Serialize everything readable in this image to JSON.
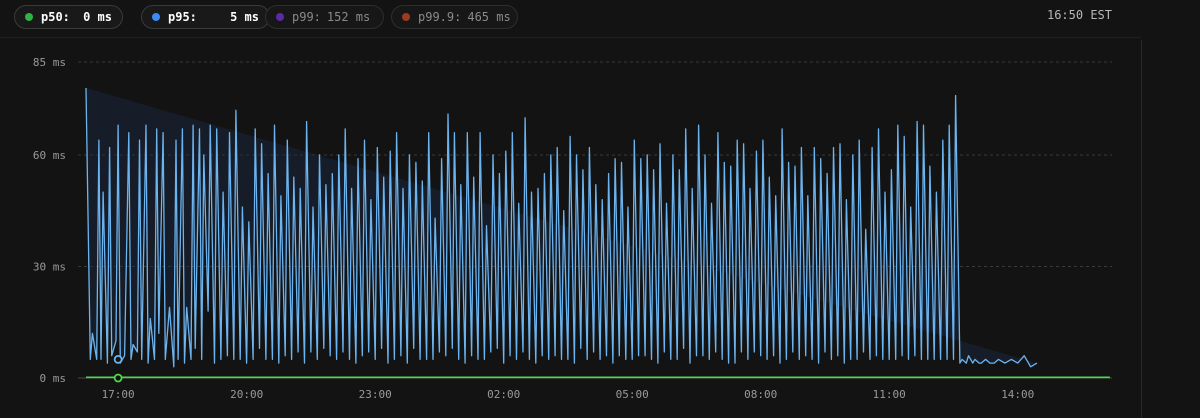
{
  "legend": [
    {
      "label": "p50:",
      "value": "0 ms",
      "color": "#2fb344",
      "active": true
    },
    {
      "label": "p95:",
      "value": "5 ms",
      "color": "#3d8bf2",
      "active": true
    },
    {
      "label": "p99:",
      "value": "152 ms",
      "color": "#5b2aa8",
      "active": false
    },
    {
      "label": "p99.9:",
      "value": "465 ms",
      "color": "#9c3b22",
      "active": false
    }
  ],
  "timestamp": "16:50 EST",
  "chart_data": {
    "type": "line",
    "y_ticks": [
      "85 ms",
      "60 ms",
      "30 ms",
      "0 ms"
    ],
    "y_tick_values": [
      85,
      60,
      30,
      0
    ],
    "ylim": [
      0,
      85
    ],
    "x_ticks": [
      "17:00",
      "20:00",
      "23:00",
      "02:00",
      "05:00",
      "08:00",
      "11:00",
      "14:00"
    ],
    "x_tick_hours": [
      17,
      20,
      23,
      26,
      29,
      32,
      35,
      38
    ],
    "xlim_hours": [
      16.25,
      40.2
    ],
    "grid": true,
    "series": [
      {
        "name": "p95",
        "color": "#6cb4f0",
        "marker_x_hours": 17.0,
        "marker_y": 5,
        "x_hours": [
          16.25,
          16.35,
          16.4,
          16.5,
          16.55,
          16.6,
          16.65,
          16.75,
          16.8,
          16.85,
          16.95,
          17.0,
          17.05,
          17.15,
          17.25,
          17.3,
          17.35,
          17.45,
          17.5,
          17.55,
          17.65,
          17.7,
          17.75,
          17.85,
          17.9,
          17.95,
          18.05,
          18.1,
          18.2,
          18.3,
          18.35,
          18.4,
          18.5,
          18.55,
          18.6,
          18.7,
          18.75,
          18.8,
          18.9,
          18.95,
          19.0,
          19.1,
          19.15,
          19.25,
          19.3,
          19.4,
          19.45,
          19.55,
          19.6,
          19.7,
          19.75,
          19.85,
          19.9,
          20.0,
          20.05,
          20.15,
          20.2,
          20.3,
          20.35,
          20.45,
          20.5,
          20.6,
          20.65,
          20.75,
          20.8,
          20.9,
          20.95,
          21.05,
          21.1,
          21.2,
          21.25,
          21.35,
          21.4,
          21.5,
          21.55,
          21.65,
          21.7,
          21.8,
          21.85,
          21.95,
          22.0,
          22.1,
          22.15,
          22.25,
          22.3,
          22.4,
          22.45,
          22.55,
          22.6,
          22.7,
          22.75,
          22.85,
          22.9,
          23.0,
          23.05,
          23.15,
          23.2,
          23.3,
          23.35,
          23.45,
          23.5,
          23.6,
          23.65,
          23.75,
          23.8,
          23.9,
          23.95,
          24.05,
          24.1,
          24.2,
          24.25,
          24.35,
          24.4,
          24.5,
          24.55,
          24.65,
          24.7,
          24.8,
          24.85,
          24.95,
          25.0,
          25.1,
          25.15,
          25.25,
          25.3,
          25.4,
          25.45,
          25.55,
          25.6,
          25.7,
          25.75,
          25.85,
          25.9,
          26.0,
          26.05,
          26.15,
          26.2,
          26.3,
          26.35,
          26.45,
          26.5,
          26.6,
          26.65,
          26.75,
          26.8,
          26.9,
          26.95,
          27.05,
          27.1,
          27.2,
          27.25,
          27.35,
          27.4,
          27.5,
          27.55,
          27.65,
          27.7,
          27.8,
          27.85,
          27.95,
          28.0,
          28.1,
          28.15,
          28.25,
          28.3,
          28.4,
          28.45,
          28.55,
          28.6,
          28.7,
          28.75,
          28.85,
          28.9,
          29.0,
          29.05,
          29.15,
          29.2,
          29.3,
          29.35,
          29.45,
          29.5,
          29.6,
          29.65,
          29.75,
          29.8,
          29.9,
          29.95,
          30.05,
          30.1,
          30.2,
          30.25,
          30.35,
          30.4,
          30.5,
          30.55,
          30.65,
          30.7,
          30.8,
          30.85,
          30.95,
          31.0,
          31.1,
          31.15,
          31.25,
          31.3,
          31.4,
          31.45,
          31.55,
          31.6,
          31.7,
          31.75,
          31.85,
          31.9,
          32.0,
          32.05,
          32.15,
          32.2,
          32.3,
          32.35,
          32.45,
          32.5,
          32.6,
          32.65,
          32.75,
          32.8,
          32.9,
          32.95,
          33.05,
          33.1,
          33.2,
          33.25,
          33.35,
          33.4,
          33.5,
          33.55,
          33.65,
          33.7,
          33.8,
          33.85,
          33.95,
          34.0,
          34.1,
          34.15,
          34.25,
          34.3,
          34.4,
          34.45,
          34.55,
          34.6,
          34.7,
          34.75,
          34.85,
          34.9,
          35.0,
          35.05,
          35.15,
          35.2,
          35.3,
          35.35,
          35.45,
          35.5,
          35.6,
          35.65,
          35.75,
          35.8,
          35.9,
          35.95,
          36.05,
          36.1,
          36.2,
          36.25,
          36.35,
          36.4,
          36.5,
          36.55,
          36.65,
          36.7,
          36.8,
          36.85,
          36.95,
          37.0,
          37.1,
          37.15,
          37.25,
          37.35,
          37.45,
          37.55,
          37.7,
          37.85,
          38.0,
          38.15,
          38.3,
          38.45,
          38.6,
          38.75,
          38.9,
          39.05,
          39.2,
          39.35,
          39.5,
          39.65,
          39.75,
          39.85,
          39.95,
          40.05,
          40.15
        ],
        "values": [
          78,
          5,
          12,
          5,
          64,
          5,
          50,
          4,
          62,
          6,
          10,
          68,
          4,
          6,
          66,
          5,
          9,
          7,
          64,
          5,
          68,
          4,
          16,
          5,
          67,
          12,
          66,
          5,
          19,
          3,
          64,
          5,
          67,
          4,
          19,
          5,
          68,
          8,
          67,
          5,
          60,
          18,
          68,
          4,
          67,
          5,
          50,
          6,
          66,
          5,
          72,
          5,
          46,
          4,
          42,
          5,
          67,
          8,
          63,
          5,
          55,
          5,
          68,
          4,
          49,
          6,
          64,
          5,
          54,
          7,
          51,
          4,
          69,
          7,
          46,
          5,
          60,
          8,
          52,
          6,
          55,
          5,
          60,
          7,
          67,
          5,
          51,
          4,
          59,
          6,
          64,
          7,
          48,
          5,
          62,
          8,
          54,
          4,
          61,
          5,
          66,
          6,
          51,
          4,
          60,
          8,
          58,
          5,
          53,
          5,
          66,
          5,
          43,
          7,
          59,
          6,
          71,
          8,
          66,
          5,
          52,
          4,
          66,
          6,
          54,
          5,
          66,
          5,
          41,
          7,
          60,
          8,
          55,
          4,
          61,
          6,
          66,
          5,
          47,
          7,
          70,
          5,
          50,
          4,
          51,
          6,
          55,
          5,
          60,
          6,
          62,
          5,
          45,
          5,
          65,
          4,
          60,
          8,
          56,
          5,
          62,
          7,
          52,
          5,
          48,
          6,
          55,
          4,
          59,
          6,
          58,
          5,
          46,
          5,
          64,
          6,
          59,
          6,
          60,
          5,
          56,
          4,
          63,
          7,
          47,
          5,
          60,
          5,
          56,
          8,
          67,
          4,
          51,
          6,
          68,
          6,
          60,
          5,
          47,
          7,
          66,
          5,
          58,
          4,
          57,
          4,
          64,
          7,
          63,
          5,
          51,
          7,
          61,
          6,
          64,
          5,
          54,
          6,
          49,
          4,
          67,
          5,
          58,
          7,
          57,
          5,
          62,
          6,
          49,
          5,
          62,
          4,
          59,
          7,
          55,
          5,
          62,
          6,
          63,
          4,
          48,
          5,
          60,
          5,
          64,
          7,
          40,
          5,
          62,
          6,
          67,
          5,
          50,
          5,
          56,
          5,
          68,
          6,
          65,
          5,
          46,
          6,
          69,
          5,
          68,
          5,
          57,
          5,
          50,
          5,
          64,
          5,
          68,
          5,
          76,
          4,
          5,
          4,
          6,
          4,
          5,
          4,
          4,
          5,
          4,
          4,
          5,
          4,
          5,
          4,
          6,
          3,
          4
        ]
      },
      {
        "name": "p50",
        "color": "#4fd84a",
        "marker_x_hours": 17.0,
        "marker_y": 0,
        "x_hours": [
          16.25,
          40.15
        ],
        "values": [
          0.2,
          0.2
        ]
      }
    ]
  }
}
